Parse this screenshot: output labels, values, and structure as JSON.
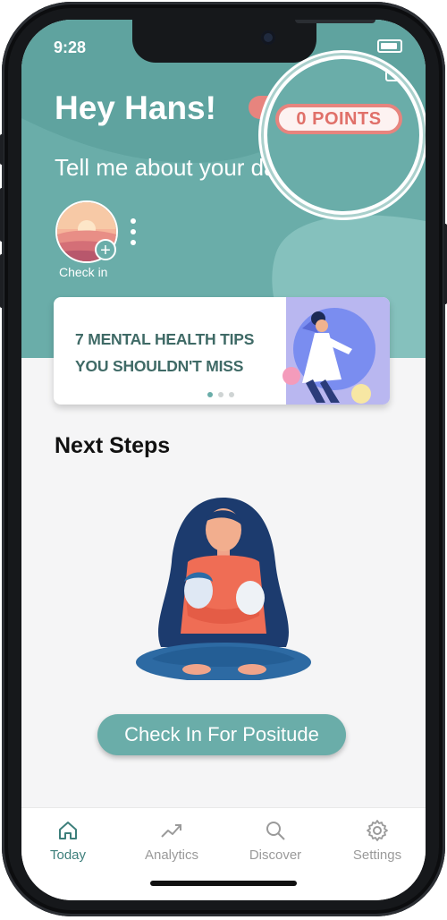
{
  "status_bar": {
    "time": "9:28"
  },
  "header": {
    "greeting": "Hey Hans!",
    "points_label": "0 POINTS",
    "prompt": "Tell me about your day"
  },
  "check_in": {
    "label": "Check in"
  },
  "tips_card": {
    "line1": "7 MENTAL HEALTH TIPS",
    "line2": "YOU SHOULDN'T MISS",
    "carousel_count": 3,
    "carousel_active": 1
  },
  "next_steps": {
    "title": "Next Steps",
    "cta_label": "Check In For Positude"
  },
  "tabs": [
    {
      "label": "Today",
      "icon": "home-icon",
      "active": true
    },
    {
      "label": "Analytics",
      "icon": "trend-icon",
      "active": false
    },
    {
      "label": "Discover",
      "icon": "search-icon",
      "active": false
    },
    {
      "label": "Settings",
      "icon": "gear-icon",
      "active": false
    }
  ],
  "colors": {
    "brand_teal": "#6aada9",
    "points_coral": "#e7847e",
    "tips_text": "#3f6a66",
    "active_tab": "#3d7f7b",
    "inactive_tab": "#9a9a9a"
  }
}
